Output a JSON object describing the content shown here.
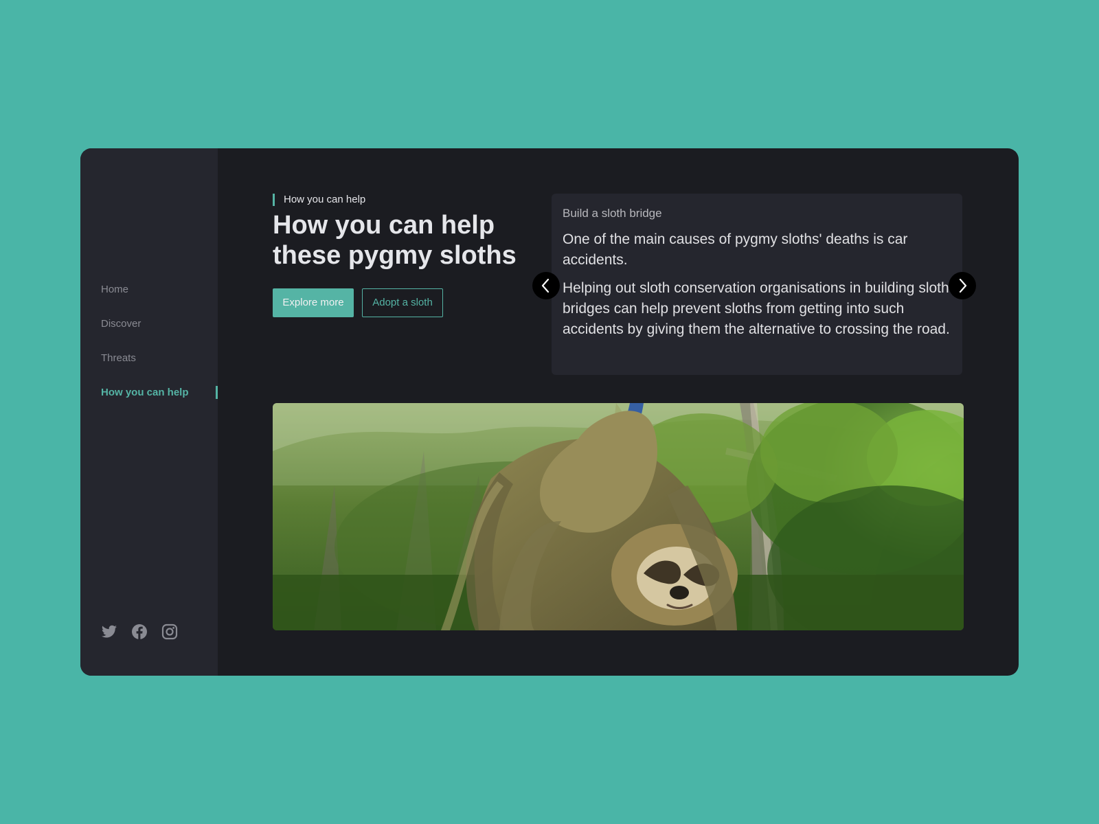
{
  "sidebar": {
    "nav": [
      {
        "label": "Home",
        "active": false
      },
      {
        "label": "Discover",
        "active": false
      },
      {
        "label": "Threats",
        "active": false
      },
      {
        "label": "How you can help",
        "active": true
      }
    ],
    "social": [
      {
        "icon": "twitter-icon"
      },
      {
        "icon": "facebook-icon"
      },
      {
        "icon": "instagram-icon"
      }
    ]
  },
  "hero": {
    "eyebrow": "How you can help",
    "title": "How you can help these pygmy sloths",
    "buttons": {
      "primary": "Explore more",
      "secondary": "Adopt a sloth"
    }
  },
  "card": {
    "label": "Build a sloth bridge",
    "paragraphs": [
      "One of the main causes of pygmy sloths' deaths is car accidents.",
      "Helping out sloth conservation organisations in building sloth bridges can help prevent sloths from getting into such accidents by giving them the alternative to crossing the road."
    ],
    "controls": {
      "prev": "chevron-left-icon",
      "next": "chevron-right-icon"
    }
  },
  "colors": {
    "page_background": "#4ab5a7",
    "panel": "#1b1c21",
    "sidebar": "#25262e",
    "accent": "#55b4a5",
    "text": "#e5e6ea"
  }
}
